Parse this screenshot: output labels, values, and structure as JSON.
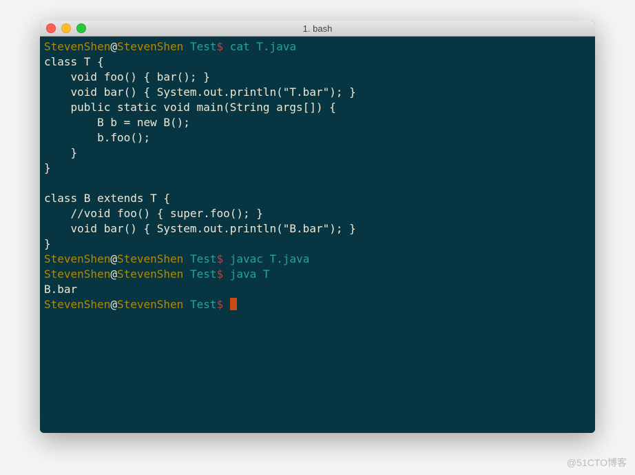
{
  "window": {
    "title": "1. bash"
  },
  "prompt": {
    "user": "StevenShen",
    "at": "@",
    "host": "StevenShen",
    "dir": "Test",
    "symbol": "$"
  },
  "session": [
    {
      "type": "cmd",
      "text": "cat T.java"
    },
    {
      "type": "out",
      "text": "class T {"
    },
    {
      "type": "out",
      "text": "    void foo() { bar(); }"
    },
    {
      "type": "out",
      "text": "    void bar() { System.out.println(\"T.bar\"); }"
    },
    {
      "type": "out",
      "text": "    public static void main(String args[]) {"
    },
    {
      "type": "out",
      "text": "        B b = new B();"
    },
    {
      "type": "out",
      "text": "        b.foo();"
    },
    {
      "type": "out",
      "text": "    }"
    },
    {
      "type": "out",
      "text": "}"
    },
    {
      "type": "out",
      "text": ""
    },
    {
      "type": "out",
      "text": "class B extends T {"
    },
    {
      "type": "out",
      "text": "    //void foo() { super.foo(); }"
    },
    {
      "type": "out",
      "text": "    void bar() { System.out.println(\"B.bar\"); }"
    },
    {
      "type": "out",
      "text": "}"
    },
    {
      "type": "cmd",
      "text": "javac T.java"
    },
    {
      "type": "cmd",
      "text": "java T"
    },
    {
      "type": "out",
      "text": "B.bar"
    },
    {
      "type": "prompt-cursor"
    }
  ],
  "watermark": "@51CTO博客",
  "colors": {
    "bg": "#073642",
    "fg": "#eee8d5",
    "user": "#b58900",
    "dir": "#2aa198",
    "dollar": "#dc322f",
    "cmd": "#2aa198",
    "cursor": "#cb4b16"
  }
}
